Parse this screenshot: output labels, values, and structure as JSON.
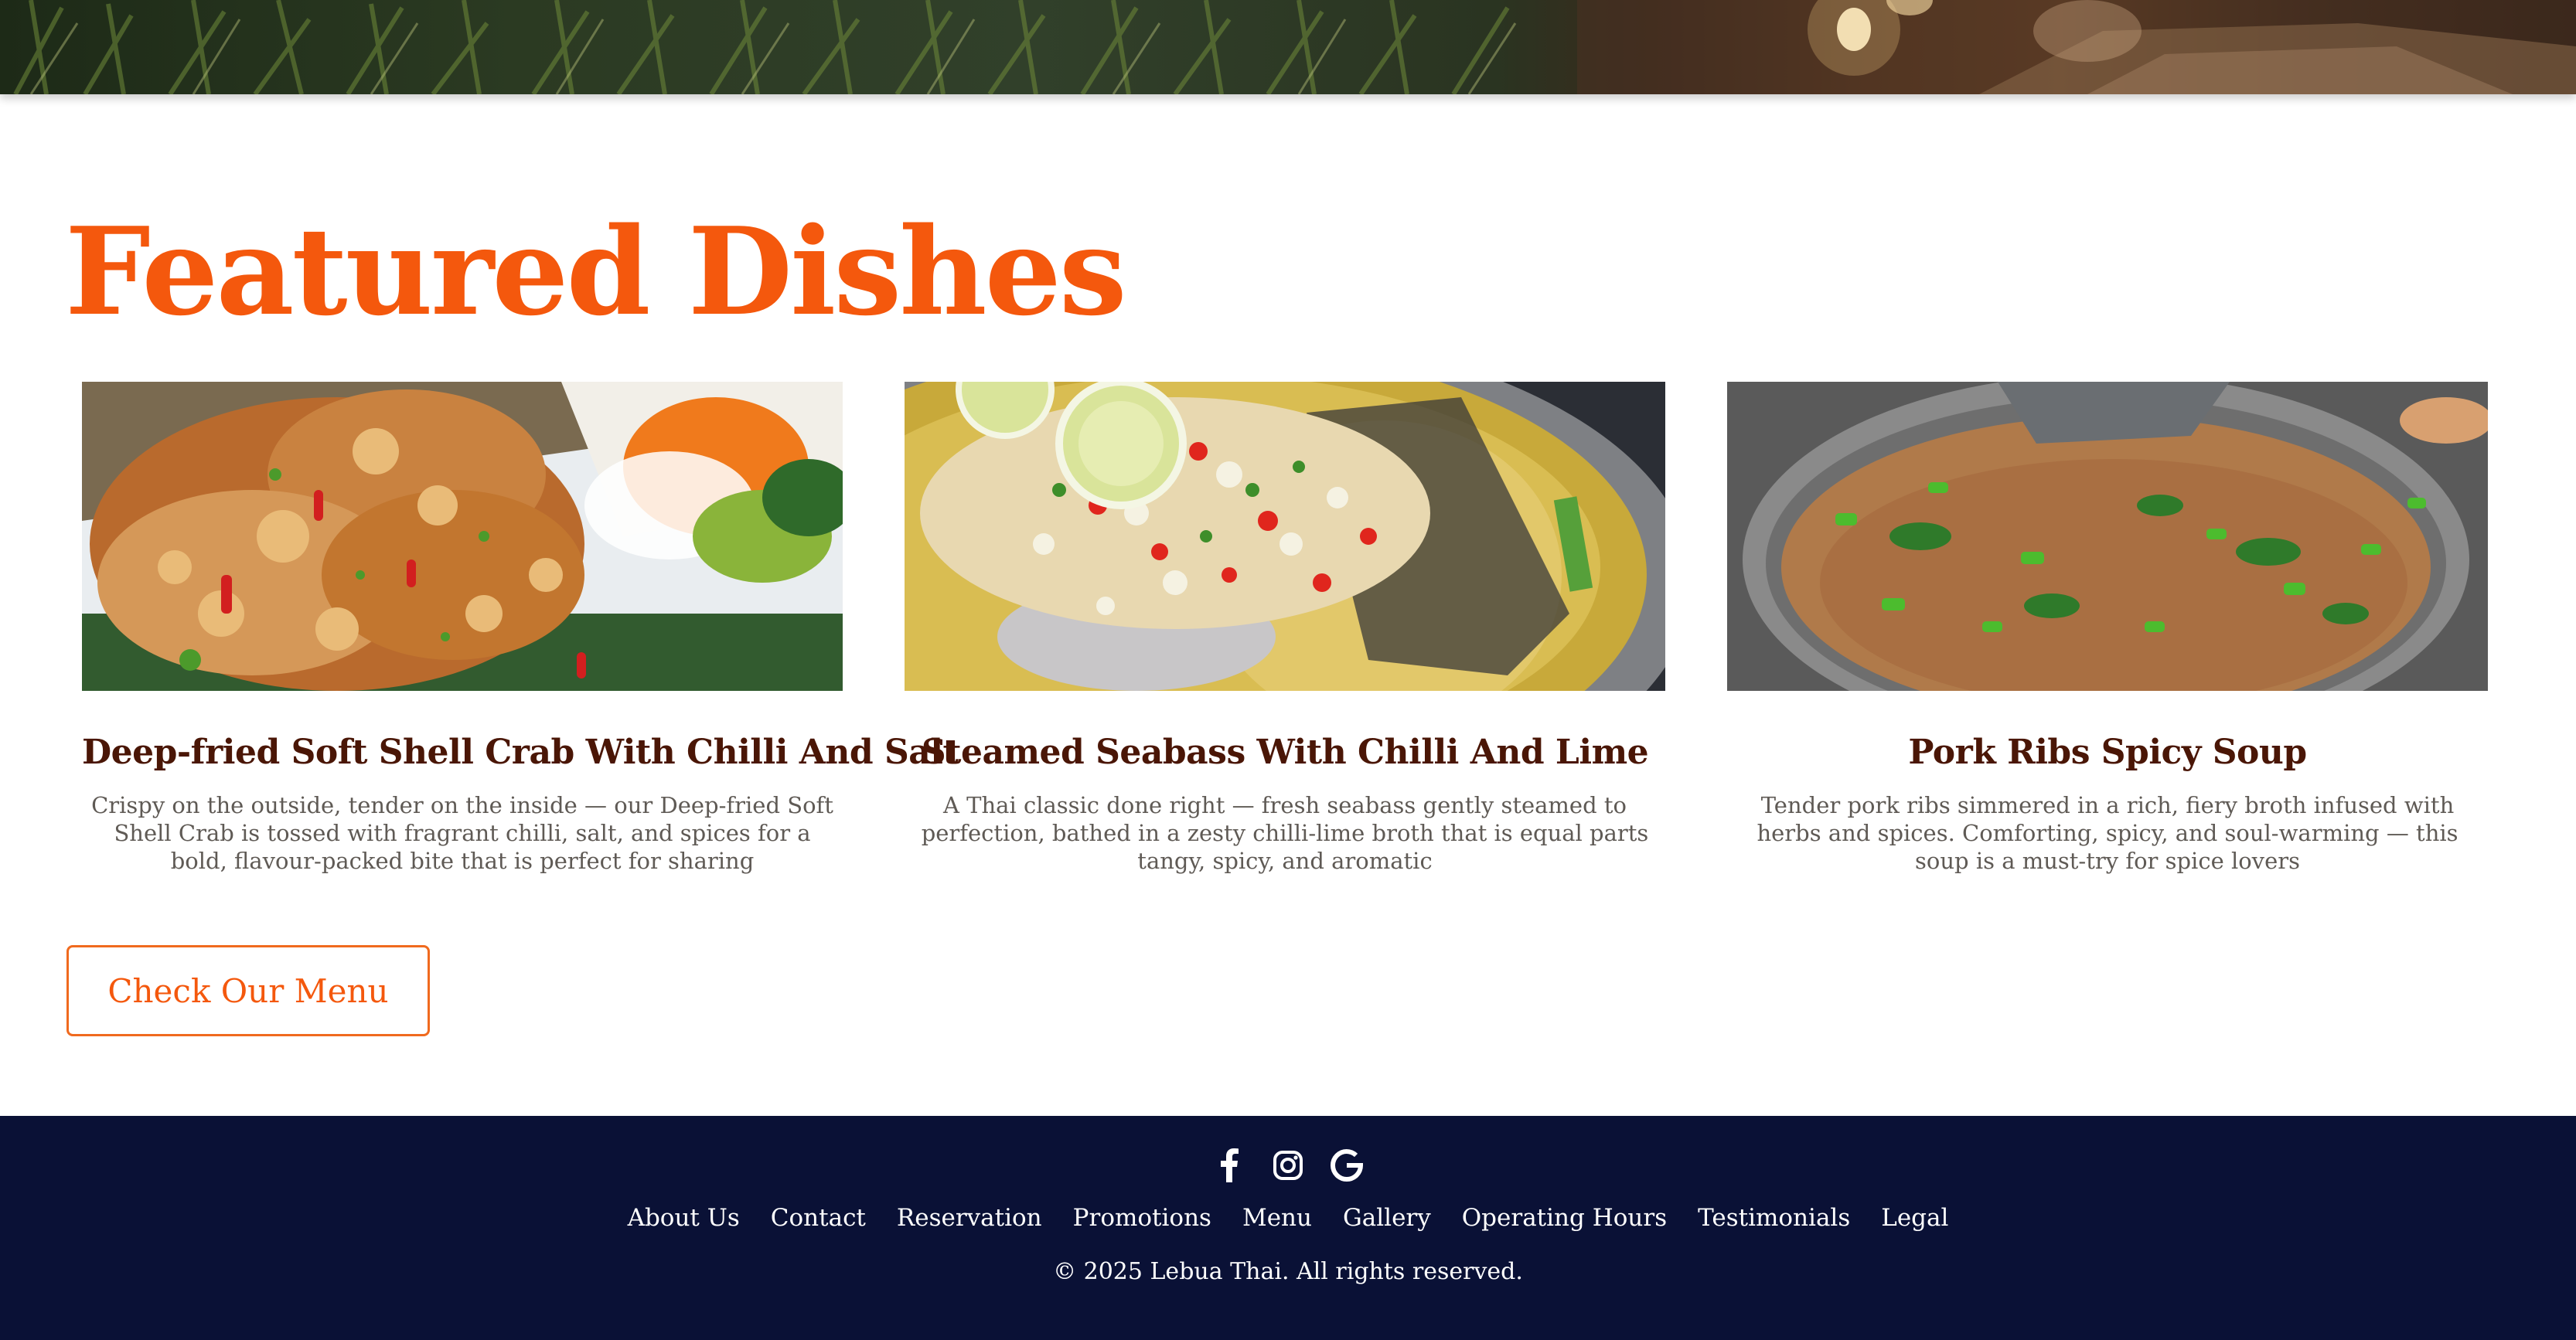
{
  "featured": {
    "title": "Featured Dishes",
    "dishes": [
      {
        "name": "Deep-fried Soft Shell Crab With Chilli And Salt",
        "description": "Crispy on the outside, tender on the inside — our Deep-fried Soft Shell Crab is tossed with fragrant chilli, salt, and spices for a bold, flavour-packed bite that is perfect for sharing"
      },
      {
        "name": "Steamed Seabass With Chilli And Lime",
        "description": "A Thai classic done right — fresh seabass gently steamed to perfection, bathed in a zesty chilli-lime broth that is equal parts tangy, spicy, and aromatic"
      },
      {
        "name": "Pork Ribs Spicy Soup",
        "description": "Tender pork ribs simmered in a rich, fiery broth infused with herbs and spices. Comforting, spicy, and soul-warming — this soup is a must-try for spice lovers"
      }
    ],
    "menu_button": "Check Our Menu"
  },
  "footer": {
    "social_icons": [
      "facebook-icon",
      "instagram-icon",
      "google-icon"
    ],
    "nav": [
      "About Us",
      "Contact",
      "Reservation",
      "Promotions",
      "Menu",
      "Gallery",
      "Operating Hours",
      "Testimonials",
      "Legal"
    ],
    "copyright": "© 2025 Lebua Thai. All rights reserved."
  },
  "colors": {
    "accent": "#f4580d",
    "dish_title": "#4a1606",
    "footer_bg": "#0a1136"
  }
}
